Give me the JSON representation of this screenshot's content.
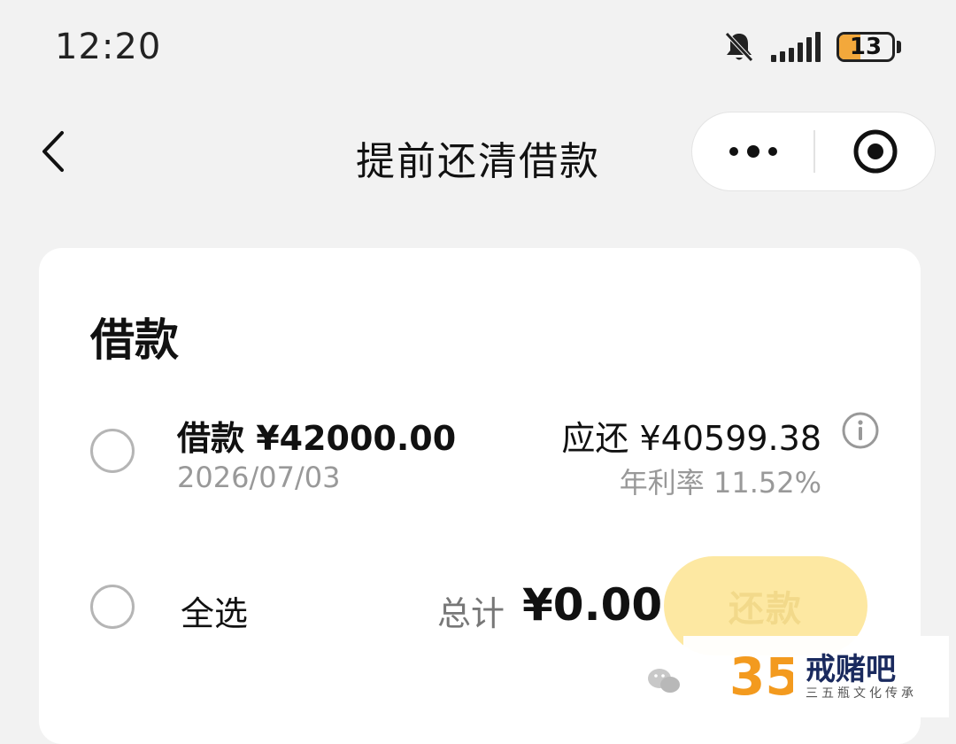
{
  "status_bar": {
    "time": "12:20",
    "battery_level": "13",
    "icons": [
      "bell-muted-icon",
      "signal-icon",
      "battery-icon"
    ]
  },
  "nav": {
    "title": "提前还清借款",
    "back_icon": "chevron-left-icon",
    "more_icon": "more-dots-icon",
    "close_icon": "target-close-icon"
  },
  "loan_section": {
    "title": "借款",
    "item": {
      "label": "借款 ¥42000.00",
      "date": "2026/07/03",
      "due": "应还 ¥40599.38",
      "rate": "年利率 11.52%",
      "selected": false
    },
    "footer": {
      "select_all": "全选",
      "total_label": "总计",
      "total_amount": "¥0.00",
      "repay_button": "还款"
    }
  },
  "watermark": {
    "brand": "戒赌吧",
    "subtitle": "三五瓶文化传承",
    "logo": "35"
  },
  "colors": {
    "background": "#f2f2f2",
    "card": "#ffffff",
    "button_disabled": "#fde8a2",
    "button_text_disabled": "#f2d98a",
    "secondary_text": "#999999",
    "battery": "#f3a83b"
  }
}
